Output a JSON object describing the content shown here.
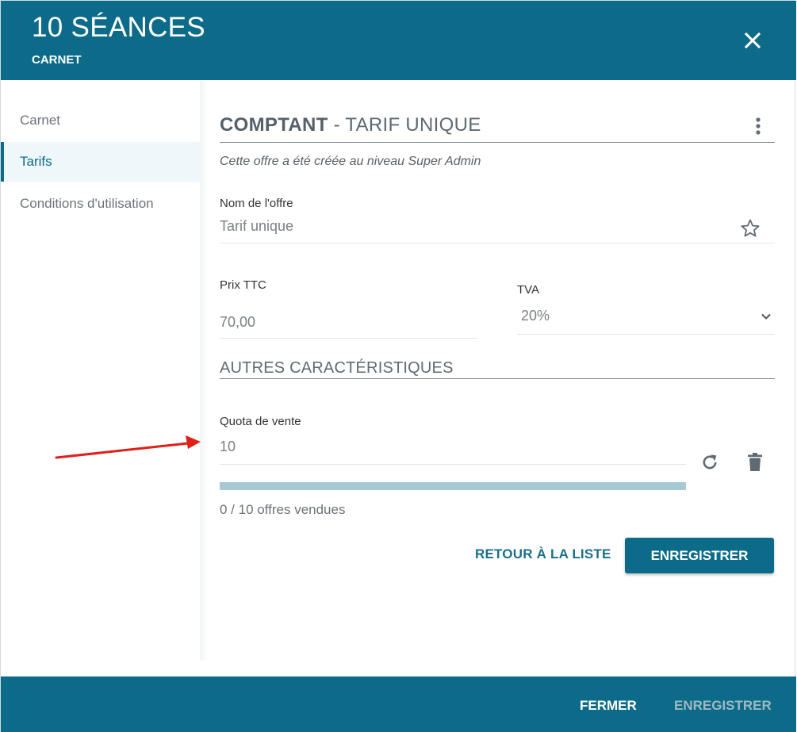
{
  "header": {
    "title": "10 SÉANCES",
    "subtitle": "CARNET",
    "close_icon": "close-icon"
  },
  "sidebar": {
    "items": [
      {
        "label": "Carnet",
        "active": false
      },
      {
        "label": "Tarifs",
        "active": true
      },
      {
        "label": "Conditions d'utilisation",
        "active": false
      }
    ]
  },
  "main": {
    "section_title_bold": "COMPTANT",
    "section_title_rest": " - TARIF UNIQUE",
    "info": "Cette offre a été créée au niveau Super Admin",
    "offer_name": {
      "label": "Nom de l'offre",
      "value": "Tarif unique"
    },
    "price": {
      "label": "Prix TTC",
      "value": "70,00"
    },
    "tva": {
      "label": "TVA",
      "selected": "20%"
    },
    "other_title": "AUTRES CARACTÉRISTIQUES",
    "quota": {
      "label": "Quota de vente",
      "value": "10"
    },
    "progress": {
      "sold": 0,
      "total": 10,
      "fraction": 0.0
    },
    "sold_text": "0 / 10 offres vendues",
    "back_label": "RETOUR À LA LISTE",
    "save_label": "ENREGISTRER"
  },
  "footer": {
    "close_label": "FERMER",
    "save_label": "ENREGISTRER"
  },
  "colors": {
    "primary": "#0b6b88",
    "progress_track": "#a6c9d3",
    "annotation_arrow": "#e0201a"
  }
}
